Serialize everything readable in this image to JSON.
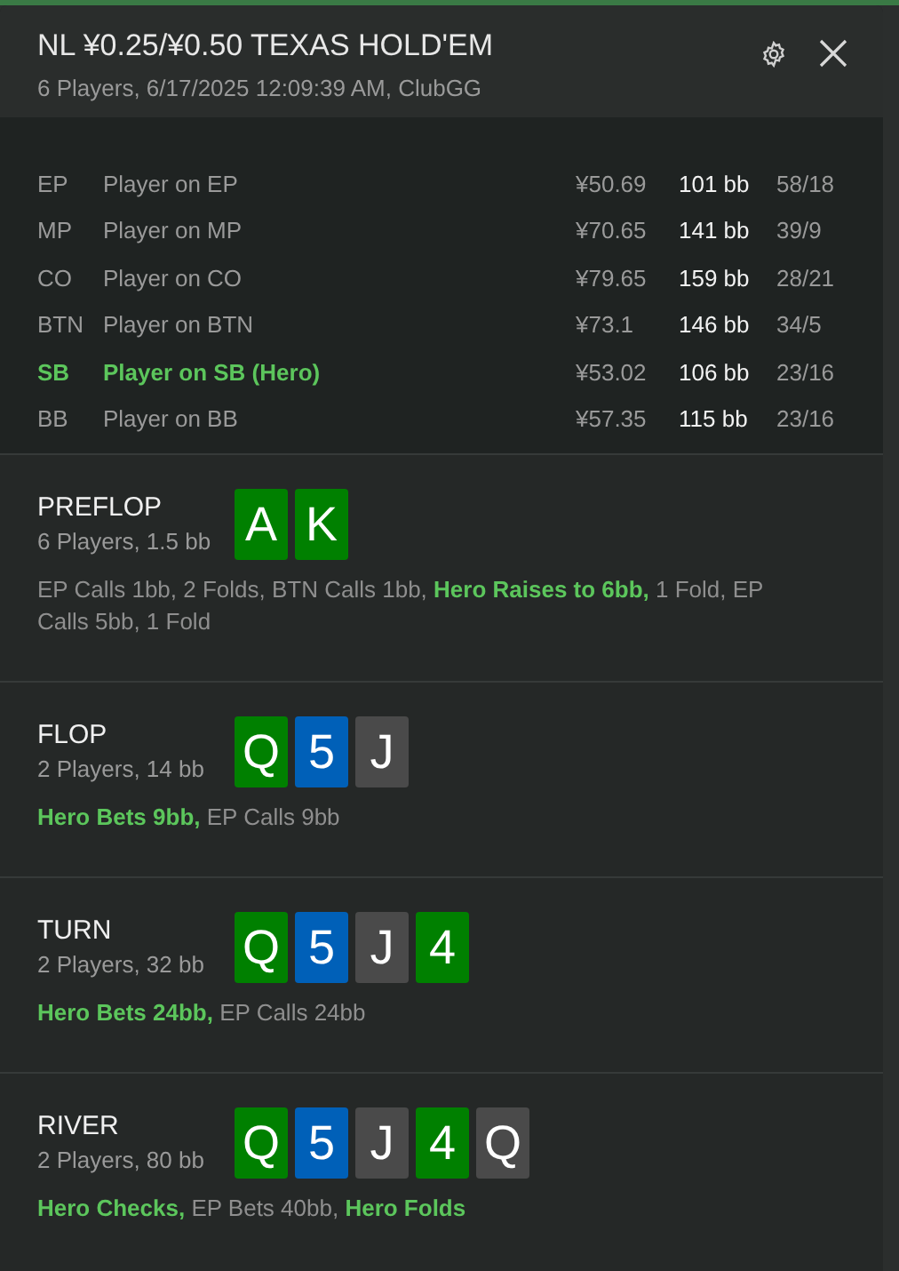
{
  "header": {
    "title": "NL ¥0.25/¥0.50 TEXAS HOLD'EM",
    "subtitle": "6 Players, 6/17/2025 12:09:39 AM, ClubGG"
  },
  "players": [
    {
      "position": "EP",
      "name": "Player on EP",
      "stack": "¥50.69",
      "bb": "101 bb",
      "stats": "58/18",
      "hero": false
    },
    {
      "position": "MP",
      "name": "Player on MP",
      "stack": "¥70.65",
      "bb": "141 bb",
      "stats": "39/9",
      "hero": false
    },
    {
      "position": "CO",
      "name": "Player on CO",
      "stack": "¥79.65",
      "bb": "159 bb",
      "stats": "28/21",
      "hero": false
    },
    {
      "position": "BTN",
      "name": "Player on BTN",
      "stack": "¥73.1",
      "bb": "146 bb",
      "stats": "34/5",
      "hero": false
    },
    {
      "position": "SB",
      "name": "Player on SB (Hero)",
      "stack": "¥53.02",
      "bb": "106 bb",
      "stats": "23/16",
      "hero": true
    },
    {
      "position": "BB",
      "name": "Player on BB",
      "stack": "¥57.35",
      "bb": "115 bb",
      "stats": "23/16",
      "hero": false
    }
  ],
  "streets": [
    {
      "name": "PREFLOP",
      "info": "6 Players, 1.5 bb",
      "cards": [
        {
          "rank": "A",
          "color": "#008000"
        },
        {
          "rank": "K",
          "color": "#008000"
        }
      ],
      "actions": [
        {
          "text": "EP Calls 1bb, 2 Folds, BTN Calls 1bb, ",
          "hero": false
        },
        {
          "text": "Hero Raises to 6bb,",
          "hero": true
        },
        {
          "text": " 1 Fold, EP Calls 5bb, 1 Fold",
          "hero": false
        }
      ]
    },
    {
      "name": "FLOP",
      "info": "2 Players, 14 bb",
      "cards": [
        {
          "rank": "Q",
          "color": "#008000"
        },
        {
          "rank": "5",
          "color": "#0060b8"
        },
        {
          "rank": "J",
          "color": "#4a4a4a"
        }
      ],
      "actions": [
        {
          "text": "Hero Bets 9bb,",
          "hero": true
        },
        {
          "text": " EP Calls 9bb",
          "hero": false
        }
      ]
    },
    {
      "name": "TURN",
      "info": "2 Players, 32 bb",
      "cards": [
        {
          "rank": "Q",
          "color": "#008000"
        },
        {
          "rank": "5",
          "color": "#0060b8"
        },
        {
          "rank": "J",
          "color": "#4a4a4a"
        },
        {
          "rank": "4",
          "color": "#008000"
        }
      ],
      "actions": [
        {
          "text": "Hero Bets 24bb,",
          "hero": true
        },
        {
          "text": " EP Calls 24bb",
          "hero": false
        }
      ]
    },
    {
      "name": "RIVER",
      "info": "2 Players, 80 bb",
      "cards": [
        {
          "rank": "Q",
          "color": "#008000"
        },
        {
          "rank": "5",
          "color": "#0060b8"
        },
        {
          "rank": "J",
          "color": "#4a4a4a"
        },
        {
          "rank": "4",
          "color": "#008000"
        },
        {
          "rank": "Q",
          "color": "#4a4a4a"
        }
      ],
      "actions": [
        {
          "text": "Hero Checks,",
          "hero": true
        },
        {
          "text": " EP Bets 40bb, ",
          "hero": false
        },
        {
          "text": "Hero Folds",
          "hero": true
        }
      ]
    }
  ]
}
